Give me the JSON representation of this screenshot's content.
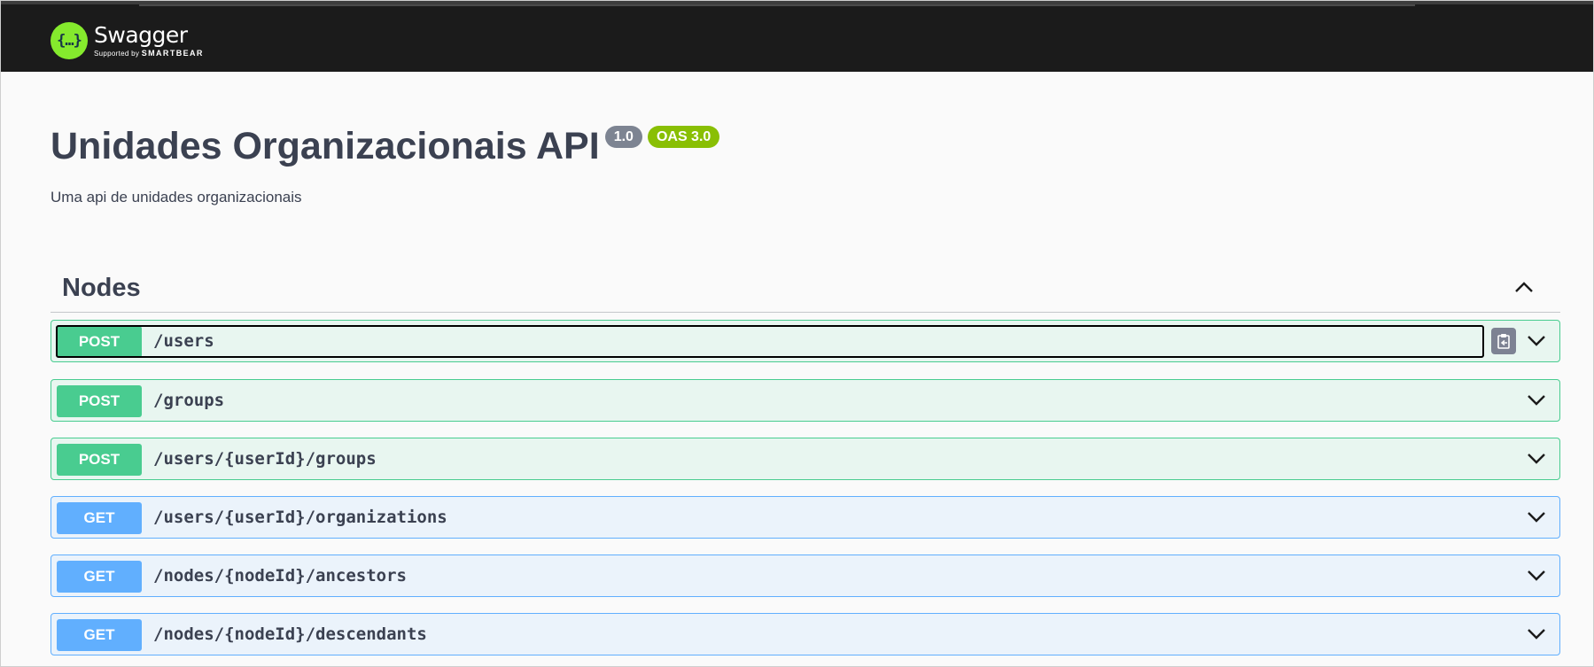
{
  "topbar": {
    "logo_glyph": "{…}",
    "brand_name": "Swagger",
    "supported_by": "Supported by",
    "company": "SMARTBEAR",
    "logo_color": "#85ea2d",
    "bar_color": "#1b1b1b"
  },
  "info": {
    "title": "Unidades Organizacionais API",
    "version": "1.0",
    "oas": "OAS 3.0",
    "description": "Uma api de unidades organizacionais"
  },
  "tag": {
    "name": "Nodes",
    "toggle_icon": "chevron-up-icon",
    "operations": [
      {
        "method": "POST",
        "path": "/users",
        "focused": true,
        "copy_icon": "clipboard-icon"
      },
      {
        "method": "POST",
        "path": "/groups"
      },
      {
        "method": "POST",
        "path": "/users/{userId}/groups"
      },
      {
        "method": "GET",
        "path": "/users/{userId}/organizations"
      },
      {
        "method": "GET",
        "path": "/nodes/{nodeId}/ancestors"
      },
      {
        "method": "GET",
        "path": "/nodes/{nodeId}/descendants"
      }
    ]
  },
  "colors": {
    "post": "#49cc90",
    "post_bg": "#e8f6f0",
    "get": "#61affe",
    "get_bg": "#ebf3fb",
    "version_badge": "#7d8492",
    "oas_badge": "#89bf04",
    "text": "#3b4151"
  }
}
